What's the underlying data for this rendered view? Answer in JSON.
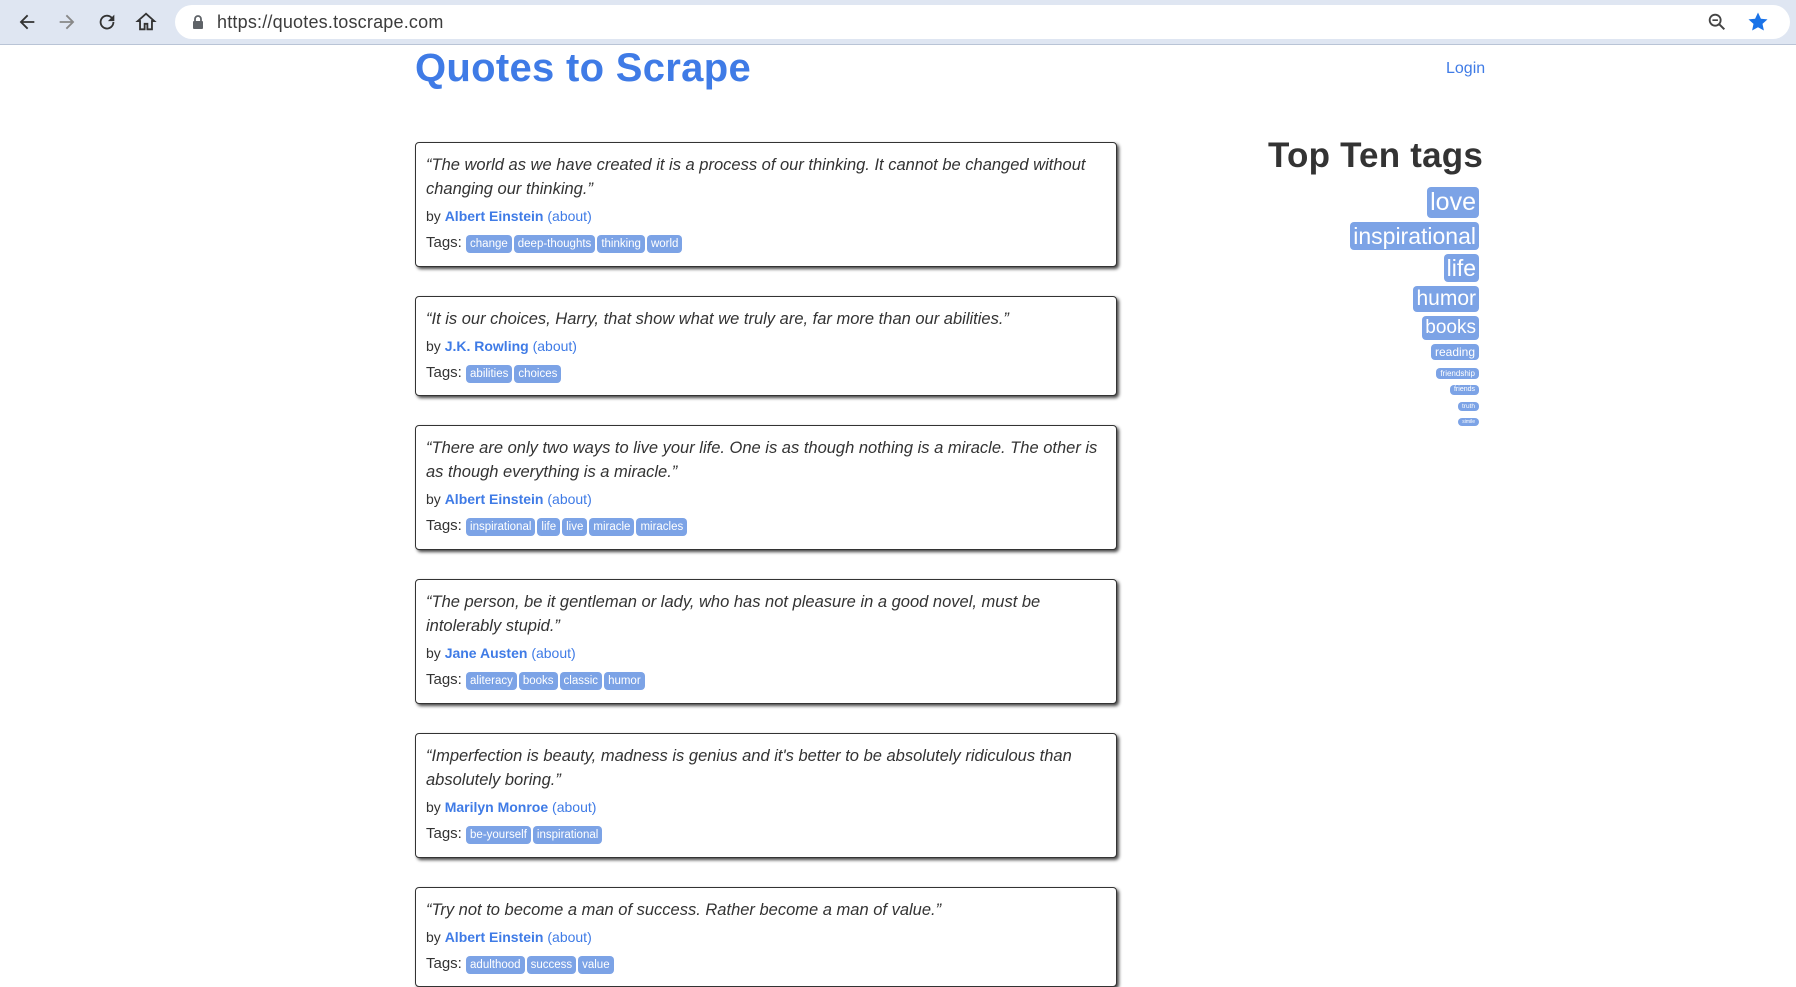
{
  "browser": {
    "url": "https://quotes.toscrape.com",
    "icons": [
      "back-arrow-icon",
      "forward-arrow-icon",
      "reload-icon",
      "home-icon",
      "lock-icon",
      "zoom-icon",
      "star-icon"
    ]
  },
  "header": {
    "title": "Quotes to Scrape",
    "login": "Login"
  },
  "quotes": [
    {
      "text": "“The world as we have created it is a process of our thinking. It cannot be changed without changing our thinking.”",
      "by": "by",
      "author": "Albert Einstein",
      "about": "(about)",
      "tags_label": "Tags:",
      "tags": [
        "change",
        "deep-thoughts",
        "thinking",
        "world"
      ]
    },
    {
      "text": "“It is our choices, Harry, that show what we truly are, far more than our abilities.”",
      "by": "by",
      "author": "J.K. Rowling",
      "about": "(about)",
      "tags_label": "Tags:",
      "tags": [
        "abilities",
        "choices"
      ]
    },
    {
      "text": "“There are only two ways to live your life. One is as though nothing is a miracle. The other is as though everything is a miracle.”",
      "by": "by",
      "author": "Albert Einstein",
      "about": "(about)",
      "tags_label": "Tags:",
      "tags": [
        "inspirational",
        "life",
        "live",
        "miracle",
        "miracles"
      ]
    },
    {
      "text": "“The person, be it gentleman or lady, who has not pleasure in a good novel, must be intolerably stupid.”",
      "by": "by",
      "author": "Jane Austen",
      "about": "(about)",
      "tags_label": "Tags:",
      "tags": [
        "aliteracy",
        "books",
        "classic",
        "humor"
      ]
    },
    {
      "text": "“Imperfection is beauty, madness is genius and it's better to be absolutely ridiculous than absolutely boring.”",
      "by": "by",
      "author": "Marilyn Monroe",
      "about": "(about)",
      "tags_label": "Tags:",
      "tags": [
        "be-yourself",
        "inspirational"
      ]
    },
    {
      "text": "“Try not to become a man of success. Rather become a man of value.”",
      "by": "by",
      "author": "Albert Einstein",
      "about": "(about)",
      "tags_label": "Tags:",
      "tags": [
        "adulthood",
        "success",
        "value"
      ]
    }
  ],
  "sidebar": {
    "heading": "Top Ten tags",
    "tags": [
      "love",
      "inspirational",
      "life",
      "humor",
      "books",
      "reading",
      "friendship",
      "friends",
      "truth",
      "simile"
    ]
  },
  "colors": {
    "accent": "#3f7be6",
    "tag_bg": "#7ca3e6",
    "chrome": "#dfe6f2"
  }
}
